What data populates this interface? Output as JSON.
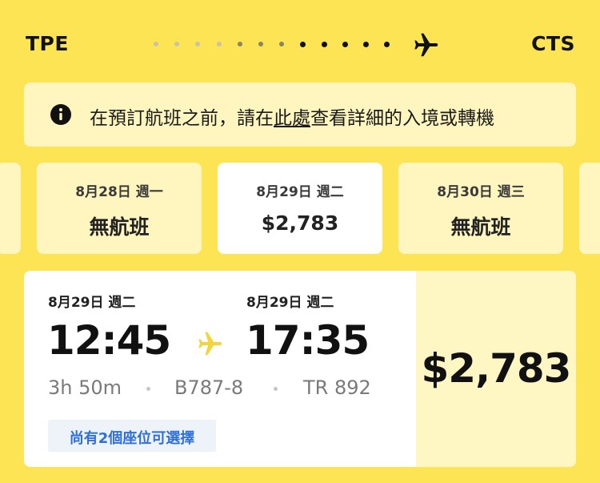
{
  "route": {
    "origin": "TPE",
    "destination": "CTS"
  },
  "colors": {
    "brand_yellow": "#FDE455",
    "pale_yellow": "#FEF5BF",
    "dot_gray": "#C9C2A6",
    "dot_dark": "#111111",
    "seat_blue": "#2F6FD8"
  },
  "icons": {
    "header_plane": "plane-icon",
    "info": "info-icon",
    "leg_plane": "plane-icon"
  },
  "info_banner": {
    "text_before": "在預訂航班之前，請在",
    "link_text": "此處",
    "text_after": "查看詳細的入境或轉機"
  },
  "date_options": [
    {
      "label": "",
      "price": ""
    },
    {
      "label": "8月28日 週一",
      "price": "無航班"
    },
    {
      "label": "8月29日 週二",
      "price": "$2,783",
      "selected": true
    },
    {
      "label": "8月30日 週三",
      "price": "無航班"
    },
    {
      "label": "",
      "price": ""
    }
  ],
  "flight": {
    "depart": {
      "date": "8月29日 週二",
      "time": "12:45"
    },
    "arrive": {
      "date": "8月29日 週二",
      "time": "17:35"
    },
    "duration": "3h 50m",
    "aircraft": "B787-8",
    "flight_number": "TR 892",
    "seats_note": "尚有2個座位可選擇",
    "price": "$2,783"
  }
}
